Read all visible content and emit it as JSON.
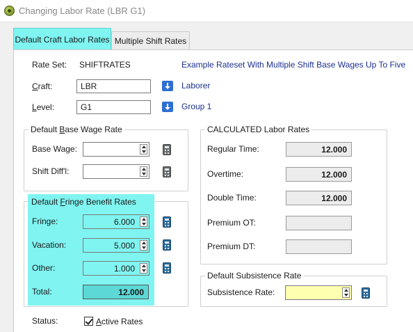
{
  "window": {
    "title": "Changing Labor Rate  (LBR G1)"
  },
  "tabs": [
    {
      "label": "Default Craft Labor Rates",
      "active": true
    },
    {
      "label": "Multiple Shift Rates",
      "active": false
    }
  ],
  "rate_set": {
    "label": "Rate Set:",
    "value": "SHIFTRATES",
    "description": "Example Rateset With Multiple Shift Base Wages Up To Five"
  },
  "craft": {
    "label_pre": "",
    "label_key": "C",
    "label_post": "raft:",
    "value": "LBR",
    "description": "Laborer"
  },
  "level": {
    "label_pre": "",
    "label_key": "L",
    "label_post": "evel:",
    "value": "G1",
    "description": "Group 1"
  },
  "base_wage_group": {
    "title_pre": "Default ",
    "title_key": "B",
    "title_post": "ase Wage Rate",
    "base_wage": {
      "label": "Base Wage:",
      "value": ""
    },
    "shift_diff": {
      "label": "Shift Diff'l:",
      "value": ""
    }
  },
  "fringe_group": {
    "title_pre": "Default ",
    "title_key": "F",
    "title_post": "ringe Benefit Rates",
    "fringe": {
      "label": "Fringe:",
      "value": "6.000"
    },
    "vacation": {
      "label": "Vacation:",
      "value": "5.000"
    },
    "other": {
      "label": "Other:",
      "value": "1.000"
    },
    "total": {
      "label": "Total:",
      "value": "12.000"
    }
  },
  "calculated_group": {
    "title": "CALCULATED Labor Rates",
    "regular_time": {
      "label": "Regular Time:",
      "value": "12.000"
    },
    "overtime": {
      "label": "Overtime:",
      "value": "12.000"
    },
    "double_time": {
      "label": "Double Time:",
      "value": "12.000"
    },
    "premium_ot": {
      "label": "Premium OT:",
      "value": ""
    },
    "premium_dt": {
      "label": "Premium DT:",
      "value": ""
    }
  },
  "subsistence_group": {
    "title": "Default Subsistence Rate",
    "subsistence": {
      "label": "Subsistence Rate:",
      "value": ""
    }
  },
  "status": {
    "label": "Status:",
    "checkbox_key": "A",
    "checkbox_post": "ctive Rates",
    "checked": true
  },
  "icons": {
    "app": "app-icon",
    "dropdown": "dropdown-arrow-icon",
    "spinner": "spinner-icon",
    "calculator": "calculator-icon",
    "check": "checkmark-icon"
  },
  "colors": {
    "highlight": "#7ff4f1",
    "link": "#1c2f8f",
    "dropdown_blue": "#2f6fd1",
    "subsistence_yellow": "#ffffb0"
  }
}
